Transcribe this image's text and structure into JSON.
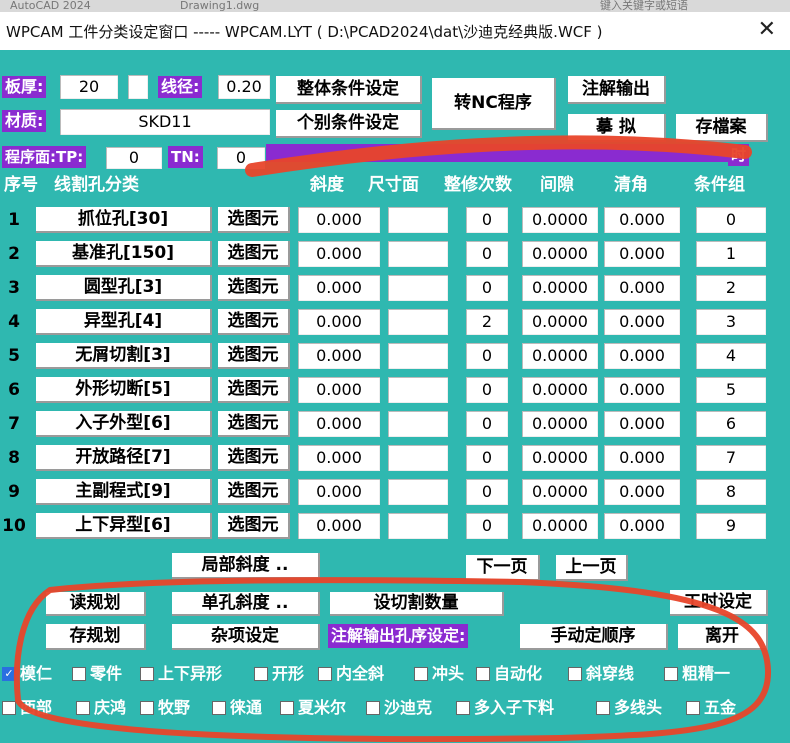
{
  "background": {
    "app_title": "AutoCAD 2024",
    "drawing_title": "Drawing1.dwg",
    "search_hint": "键入关键字或短语"
  },
  "window": {
    "title": "WPCAM 工件分类设定窗口 ----- WPCAM.LYT ( D:\\PCAD2024\\dat\\沙迪克经典版.WCF )",
    "close_symbol": "✕"
  },
  "top": {
    "thickness_label": "板厚:",
    "thickness_value": "20",
    "wire_label": "线径:",
    "wire_value": "0.20",
    "material_label": "材质:",
    "material_value": "SKD11",
    "program_face_label": "程序面:TP:",
    "tp_value": "0",
    "tn_label": "TN:",
    "tn_value": "0",
    "overall_cond_button": "整体条件设定",
    "individual_cond_button": "个别条件设定",
    "to_nc_button": "转NC程序",
    "annotation_output_button": "注解输出",
    "simulate_button": "摹 拟",
    "save_file_button": "存檔案",
    "hidden_right_label": "时"
  },
  "table": {
    "headers": {
      "seq": "序号",
      "category": "线割孔分类",
      "slope": "斜度",
      "size_face": "尺寸面",
      "trim_count": "整修次数",
      "gap": "间隙",
      "corner": "清角",
      "cond_group": "条件组"
    },
    "select_label": "选图元",
    "rows": [
      {
        "num": "1",
        "name": "抓位孔[30]",
        "slope": "0.000",
        "size_face": "",
        "trim": "0",
        "gap": "0.0000",
        "corner": "0.000",
        "group": "0"
      },
      {
        "num": "2",
        "name": "基准孔[150]",
        "slope": "0.000",
        "size_face": "",
        "trim": "0",
        "gap": "0.0000",
        "corner": "0.000",
        "group": "1"
      },
      {
        "num": "3",
        "name": "圆型孔[3]",
        "slope": "0.000",
        "size_face": "",
        "trim": "0",
        "gap": "0.0000",
        "corner": "0.000",
        "group": "2"
      },
      {
        "num": "4",
        "name": "异型孔[4]",
        "slope": "0.000",
        "size_face": "",
        "trim": "2",
        "gap": "0.0000",
        "corner": "0.000",
        "group": "3"
      },
      {
        "num": "5",
        "name": "无屑切割[3]",
        "slope": "0.000",
        "size_face": "",
        "trim": "0",
        "gap": "0.0000",
        "corner": "0.000",
        "group": "4"
      },
      {
        "num": "6",
        "name": "外形切断[5]",
        "slope": "0.000",
        "size_face": "",
        "trim": "0",
        "gap": "0.0000",
        "corner": "0.000",
        "group": "5"
      },
      {
        "num": "7",
        "name": "入子外型[6]",
        "slope": "0.000",
        "size_face": "",
        "trim": "0",
        "gap": "0.0000",
        "corner": "0.000",
        "group": "6"
      },
      {
        "num": "8",
        "name": "开放路径[7]",
        "slope": "0.000",
        "size_face": "",
        "trim": "0",
        "gap": "0.0000",
        "corner": "0.000",
        "group": "7"
      },
      {
        "num": "9",
        "name": "主副程式[9]",
        "slope": "0.000",
        "size_face": "",
        "trim": "0",
        "gap": "0.0000",
        "corner": "0.000",
        "group": "8"
      },
      {
        "num": "10",
        "name": "上下异型[6]",
        "slope": "0.000",
        "size_face": "",
        "trim": "0",
        "gap": "0.0000",
        "corner": "0.000",
        "group": "9"
      }
    ]
  },
  "nav": {
    "local_slope_button": "局部斜度 ..",
    "next_page_button": "下一页",
    "prev_page_button": "上一页"
  },
  "bottom": {
    "read_plan_button": "读规划",
    "single_hole_slope_button": "单孔斜度 ..",
    "cut_count_button": "设切割数量",
    "work_hours_button": "工时设定",
    "save_plan_button": "存规划",
    "misc_settings_button": "杂项设定",
    "annotation_order_label": "注解输出孔序设定:",
    "manual_order_button": "手动定顺序",
    "leave_button": "离开"
  },
  "checkboxes_row1": [
    {
      "label": "模仁",
      "checked": true
    },
    {
      "label": "零件",
      "checked": false
    },
    {
      "label": "上下异形",
      "checked": false
    },
    {
      "label": "开形",
      "checked": false
    },
    {
      "label": "内全斜",
      "checked": false
    },
    {
      "label": "冲头",
      "checked": false
    },
    {
      "label": "自动化",
      "checked": false
    },
    {
      "label": "斜穿线",
      "checked": false
    },
    {
      "label": "粗精一",
      "checked": false
    }
  ],
  "checkboxes_row2": [
    {
      "label": "西部",
      "checked": false
    },
    {
      "label": "庆鸿",
      "checked": false
    },
    {
      "label": "牧野",
      "checked": false
    },
    {
      "label": "徕通",
      "checked": false
    },
    {
      "label": "夏米尔",
      "checked": false
    },
    {
      "label": "沙迪克",
      "checked": false
    },
    {
      "label": "多入子下料",
      "checked": false
    },
    {
      "label": "多线头",
      "checked": false
    },
    {
      "label": "五金",
      "checked": false
    }
  ],
  "colors": {
    "panel_bg": "#2fb8b0",
    "purple_label": "#8a2bd0",
    "annotation_red": "#e8442a"
  }
}
